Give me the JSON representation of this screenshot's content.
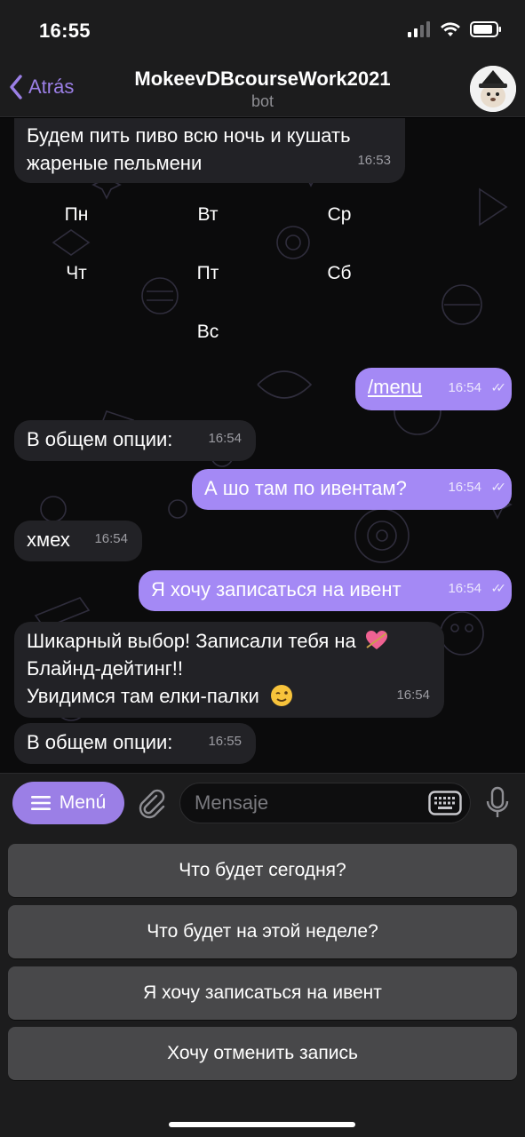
{
  "status": {
    "time": "16:55"
  },
  "nav": {
    "back_label": "Atrás",
    "title": "MokeevDBcourseWork2021",
    "subtitle": "bot"
  },
  "messages": [
    {
      "text": "Будем пить пиво всю ночь и кушать\nжареные пельмени",
      "time": "16:53"
    },
    {
      "text": "/menu",
      "time": "16:54"
    },
    {
      "text": "В общем опции:",
      "time": "16:54"
    },
    {
      "text": "А шо там по ивентам?",
      "time": "16:54"
    },
    {
      "text": "хмех",
      "time": "16:54"
    },
    {
      "text": "Я хочу записаться на ивент",
      "time": "16:54"
    },
    {
      "line1": "Шикарный выбор! Записали тебя на",
      "line2": "Блайнд-дейтинг!!",
      "line3": "Увидимся там елки-палки",
      "time": "16:54"
    },
    {
      "text": "В общем опции:",
      "time": "16:55"
    }
  ],
  "inline_days": [
    "Пн",
    "Вт",
    "Ср",
    "Чт",
    "Пт",
    "Сб",
    "Вс"
  ],
  "input": {
    "menu_label": "Menú",
    "placeholder": "Mensaje"
  },
  "reply_keyboard": [
    "Что будет сегодня?",
    "Что будет на этой неделе?",
    "Я хочу записаться на ивент",
    "Хочу отменить запись"
  ],
  "colors": {
    "accent": "#9b7fe6",
    "outgoing_bubble": "#a489f5",
    "incoming_bubble": "#222226"
  }
}
